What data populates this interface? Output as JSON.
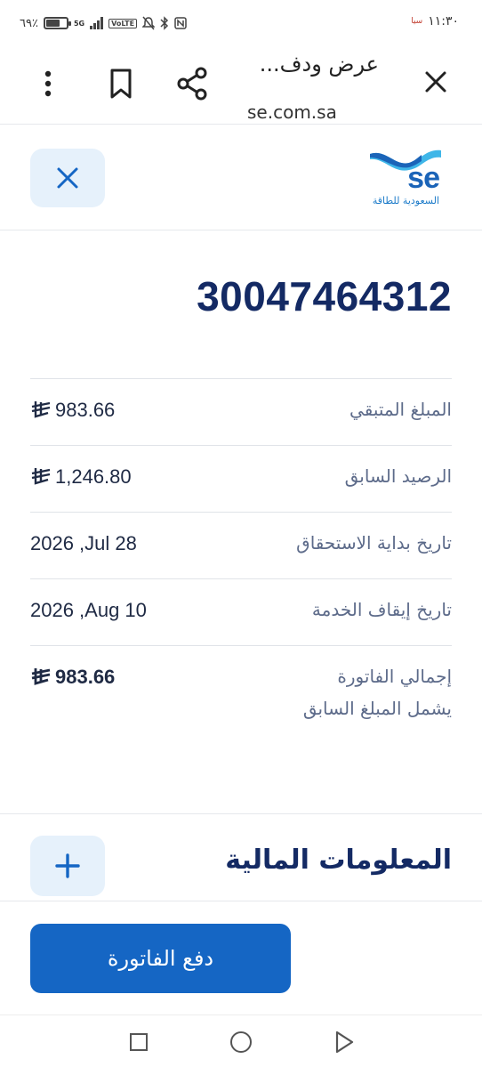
{
  "status_bar": {
    "battery_text": "٦٩٪",
    "battery_level": 0.69,
    "network": "5G",
    "volte": "VoLTE",
    "time": "١١:٣٠",
    "carrier_badge": "سيا"
  },
  "browser": {
    "title": "عرض ودف...",
    "url": "se.com.sa"
  },
  "logo": {
    "text": "se",
    "caption": "السعودية للطاقة"
  },
  "account": {
    "number": "30047464312"
  },
  "details": [
    {
      "label": "المبلغ المتبقي",
      "value": "983.66",
      "currency": "ريال"
    },
    {
      "label": "الرصيد السابق",
      "value": "1,246.80",
      "currency": "ريال"
    },
    {
      "label": "تاريخ بداية الاستحقاق",
      "value": "2026 ,Jul 28"
    },
    {
      "label": "تاريخ إيقاف الخدمة",
      "value": "2026 ,Aug 10"
    }
  ],
  "total": {
    "label": "إجمالي الفاتورة",
    "sublabel": "يشمل المبلغ السابق",
    "value": "983.66"
  },
  "financial_info": {
    "title": "المعلومات المالية"
  },
  "pay_button": {
    "label": "دفع الفاتورة"
  },
  "colors": {
    "primary": "#1566c4",
    "heading": "#142a64",
    "soft_button_bg": "#e6f1fb"
  }
}
